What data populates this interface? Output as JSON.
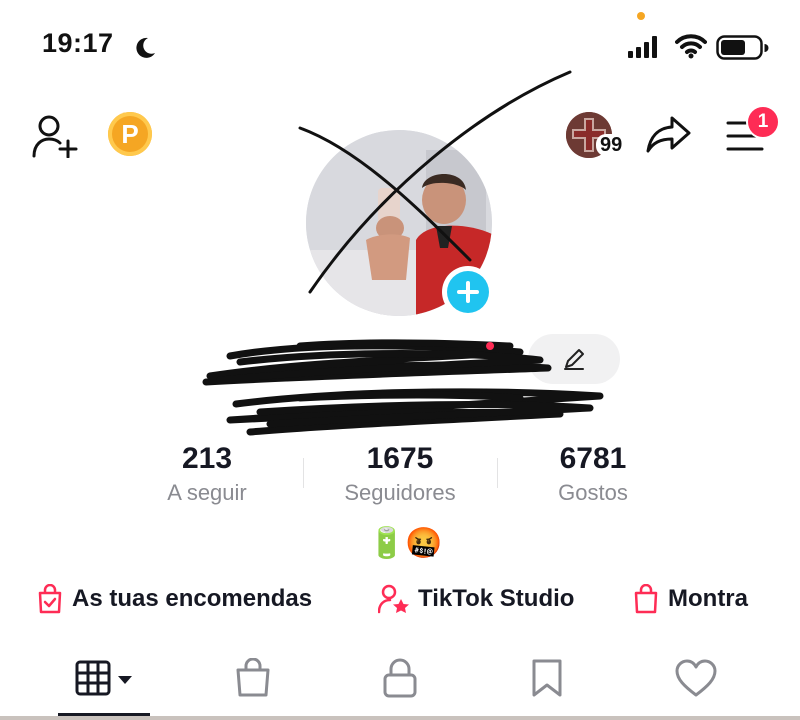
{
  "status_bar": {
    "time": "19:17",
    "icons": [
      "moon-icon",
      "signal-icon",
      "wifi-icon",
      "battery-icon"
    ],
    "orange_dot_color": "#f5a623"
  },
  "top_bar": {
    "coin_letter": "P",
    "coin_color": "#f5a623",
    "visitor_count": "99",
    "menu_badge": "1",
    "badge_color": "#fe2c55"
  },
  "profile": {
    "name": "",
    "handle": ""
  },
  "stats": [
    {
      "value": "213",
      "label": "A seguir"
    },
    {
      "value": "1675",
      "label": "Seguidores"
    },
    {
      "value": "6781",
      "label": "Gostos"
    }
  ],
  "bio": "🔋🤬",
  "links": [
    {
      "label": "As tuas encomendas",
      "icon": "shopping-bag-check-icon"
    },
    {
      "label": "TikTok Studio",
      "icon": "person-star-icon"
    },
    {
      "label": "Montra",
      "icon": "shopping-bag-icon"
    }
  ],
  "accent_color": "#fe2c55",
  "plus_color": "#20c4f0",
  "tabs": [
    {
      "name": "videos-grid",
      "icon": "grid-icon",
      "selected": true
    },
    {
      "name": "shop",
      "icon": "bag-icon",
      "selected": false
    },
    {
      "name": "private",
      "icon": "lock-icon",
      "selected": false
    },
    {
      "name": "saved",
      "icon": "bookmark-icon",
      "selected": false
    },
    {
      "name": "liked",
      "icon": "heart-icon",
      "selected": false
    }
  ]
}
